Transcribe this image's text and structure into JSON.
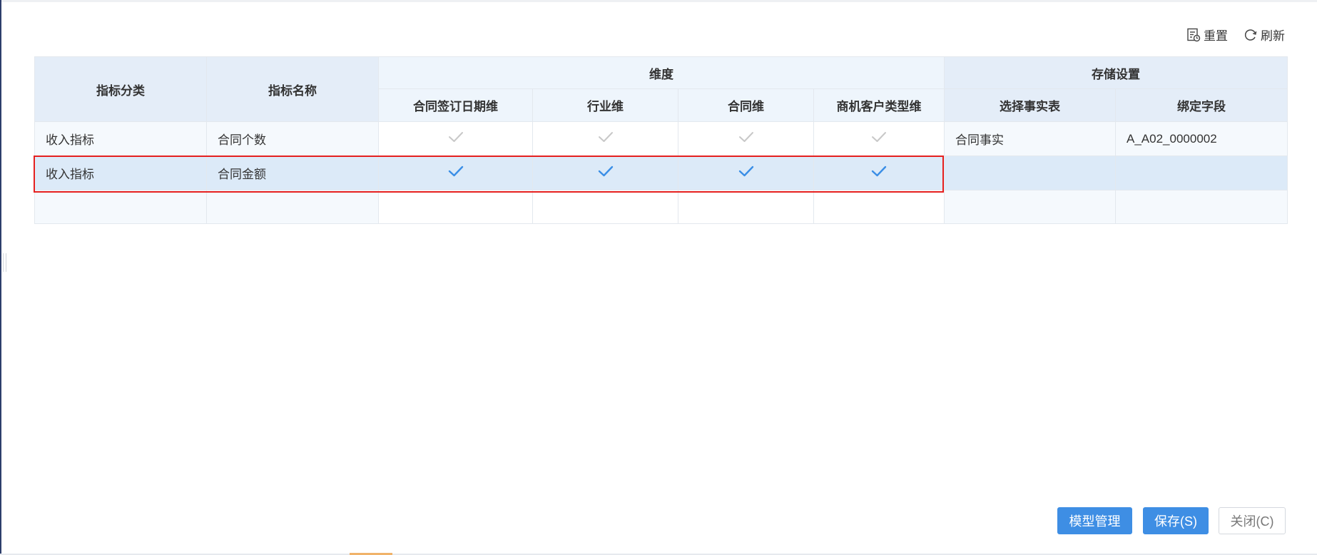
{
  "toolbar": {
    "reset_label": "重置",
    "refresh_label": "刷新"
  },
  "table": {
    "header": {
      "category": "指标分类",
      "name": "指标名称",
      "dimension_group": "维度",
      "storage_group": "存储设置",
      "dimensions": [
        "合同签订日期维",
        "行业维",
        "合同维",
        "商机客户类型维"
      ],
      "storage": [
        "选择事实表",
        "绑定字段"
      ]
    },
    "rows": [
      {
        "category": "收入指标",
        "name": "合同个数",
        "checks": [
          "inactive",
          "inactive",
          "inactive",
          "inactive"
        ],
        "fact_table": "合同事实",
        "bind_field": "A_A02_0000002",
        "selected": false
      },
      {
        "category": "收入指标",
        "name": "合同金额",
        "checks": [
          "active",
          "active",
          "active",
          "active"
        ],
        "fact_table": "",
        "bind_field": "",
        "selected": true
      }
    ]
  },
  "colors": {
    "check_active": "#3a8ee6",
    "check_inactive": "#c8c8c8",
    "highlight": "#e5201f",
    "primary": "#3e8ee4"
  },
  "buttons": {
    "model_manage": "模型管理",
    "save": "保存(S)",
    "close": "关闭(C)"
  }
}
